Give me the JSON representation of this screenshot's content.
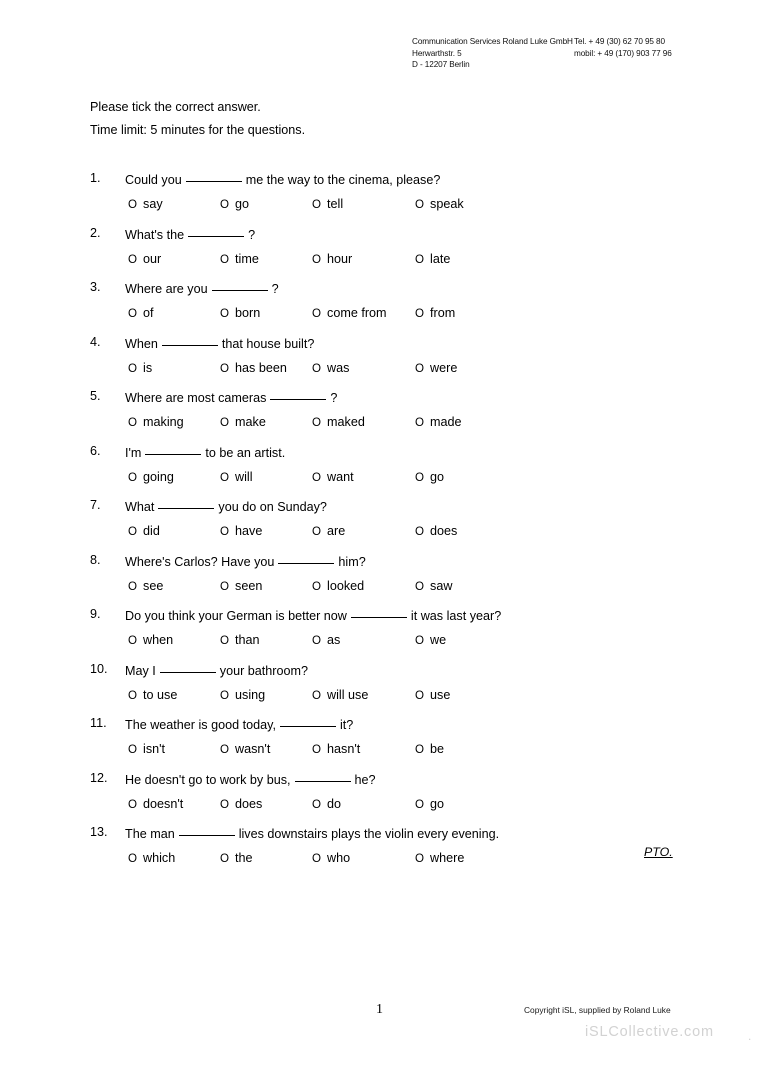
{
  "letterhead": {
    "company": "Communication Services Roland Luke GmbH",
    "street": "Herwarthstr. 5",
    "city": "D - 12207 Berlin",
    "tel": "Tel. + 49 (30) 62 70 95 80",
    "mobile": "mobil: + 49 (170) 903 77 96"
  },
  "instructions": {
    "line1": "Please tick the correct answer.",
    "line2": "Time limit: 5 minutes for the questions."
  },
  "circle_glyph": "O",
  "questions": [
    {
      "number": "1.",
      "text_before": "Could you",
      "text_after": "me the way to the cinema, please?",
      "options": [
        "say",
        "go",
        "tell",
        "speak"
      ]
    },
    {
      "number": "2.",
      "text_before": "What's the",
      "text_after": "?",
      "options": [
        "our",
        "time",
        "hour",
        "late"
      ]
    },
    {
      "number": "3.",
      "text_before": "Where are you",
      "text_after": "?",
      "options": [
        "of",
        "born",
        "come from",
        "from"
      ]
    },
    {
      "number": "4.",
      "text_before": "When",
      "text_after": "that house built?",
      "options": [
        "is",
        "has been",
        "was",
        "were"
      ]
    },
    {
      "number": "5.",
      "text_before": "Where are most cameras",
      "text_after": "?",
      "options": [
        "making",
        "make",
        "maked",
        "made"
      ]
    },
    {
      "number": "6.",
      "text_before": "I'm",
      "text_after": "to be an artist.",
      "options": [
        "going",
        "will",
        "want",
        "go"
      ]
    },
    {
      "number": "7.",
      "text_before": "What",
      "text_after": "you do on Sunday?",
      "options": [
        "did",
        "have",
        "are",
        "does"
      ]
    },
    {
      "number": "8.",
      "text_before": "Where's Carlos? Have you",
      "text_after": "him?",
      "options": [
        "see",
        "seen",
        "looked",
        "saw"
      ]
    },
    {
      "number": "9.",
      "text_before": "Do you think your German is better now",
      "text_after": "it was last year?",
      "options": [
        "when",
        "than",
        "as",
        "we"
      ]
    },
    {
      "number": "10.",
      "text_before": "May I",
      "text_after": "your bathroom?",
      "options": [
        "to use",
        "using",
        "will use",
        "use"
      ]
    },
    {
      "number": "11.",
      "text_before": "The weather is good today,",
      "text_after": "it?",
      "options": [
        "isn't",
        "wasn't",
        "hasn't",
        "be"
      ]
    },
    {
      "number": "12.",
      "text_before": "He doesn't go to work by bus,",
      "text_after": "he?",
      "options": [
        "doesn't",
        "does",
        "do",
        "go"
      ]
    },
    {
      "number": "13.",
      "text_before": "The man",
      "text_after": "lives downstairs plays the violin every evening.",
      "options": [
        "which",
        "the",
        "who",
        "where"
      ]
    }
  ],
  "pto": "PTO.",
  "footer": {
    "page_number": "1",
    "copyright": "Copyright iSL, supplied by Roland Luke",
    "watermark": "iSLCollective.com",
    "watermark_dot": "."
  }
}
